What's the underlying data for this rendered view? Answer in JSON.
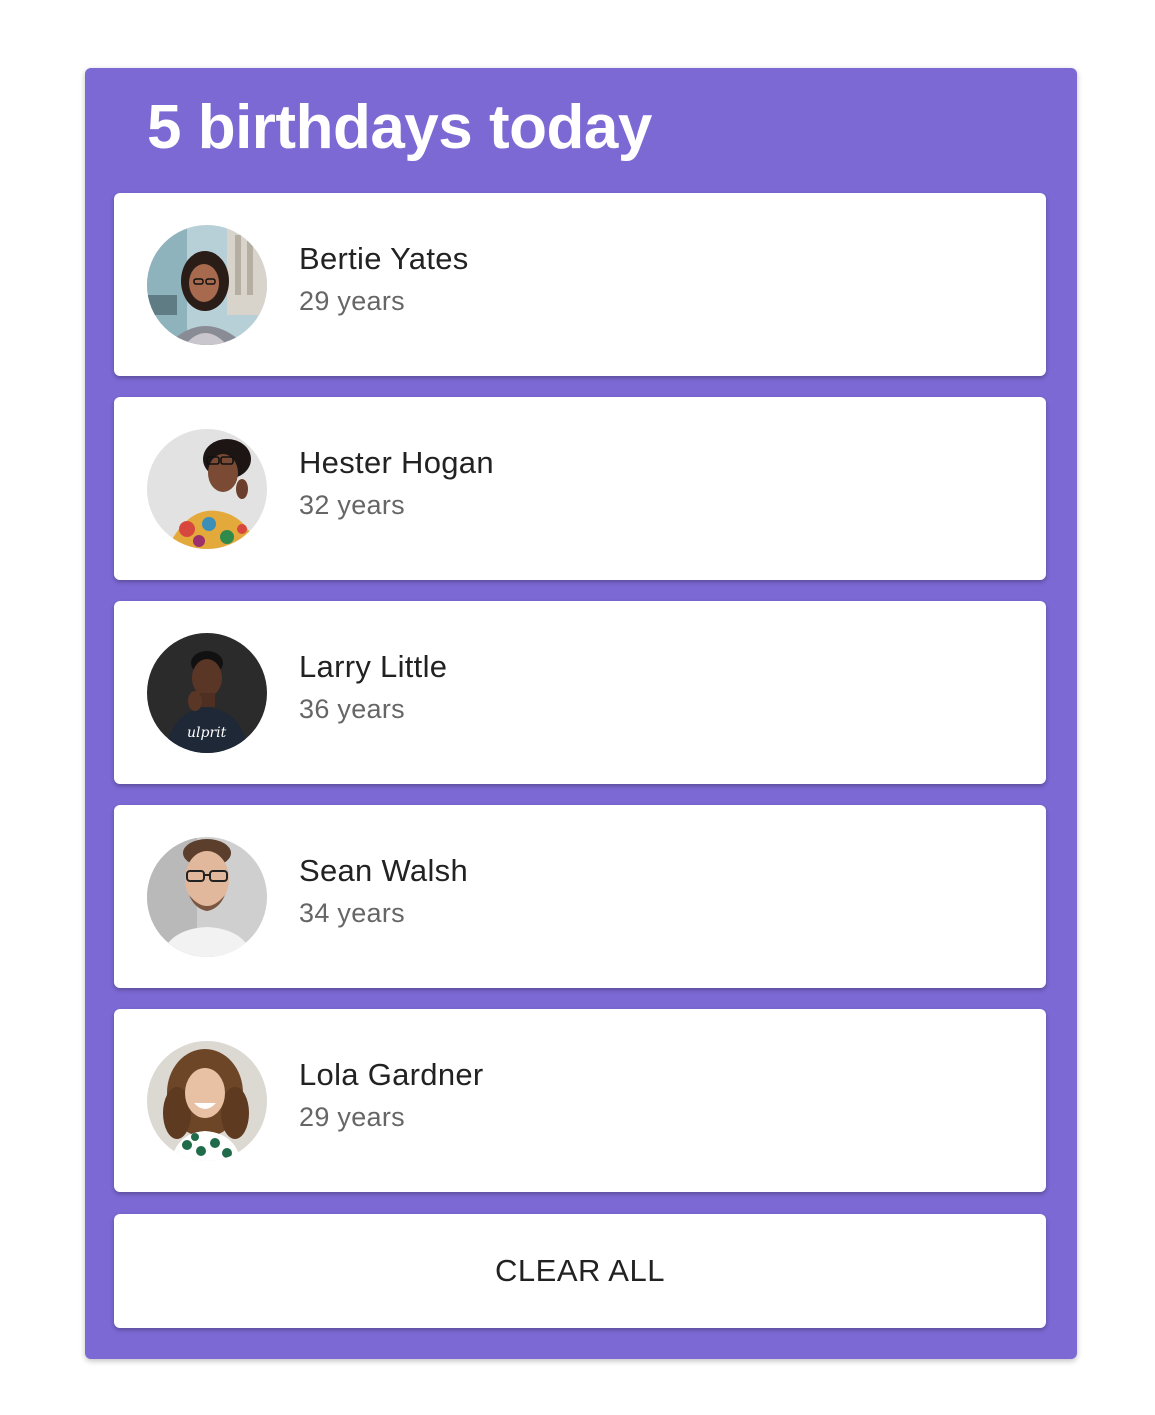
{
  "title": "5 birthdays today",
  "accent_color": "#7c69d4",
  "people": [
    {
      "name": "Bertie Yates",
      "age": "29 years",
      "avatar_icon": "person-photo-bertie"
    },
    {
      "name": "Hester Hogan",
      "age": "32 years",
      "avatar_icon": "person-photo-hester"
    },
    {
      "name": "Larry Little",
      "age": "36 years",
      "avatar_icon": "person-photo-larry"
    },
    {
      "name": "Sean Walsh",
      "age": "34 years",
      "avatar_icon": "person-photo-sean"
    },
    {
      "name": "Lola Gardner",
      "age": "29 years",
      "avatar_icon": "person-photo-lola"
    }
  ],
  "clear_button": {
    "label": "CLEAR ALL"
  }
}
